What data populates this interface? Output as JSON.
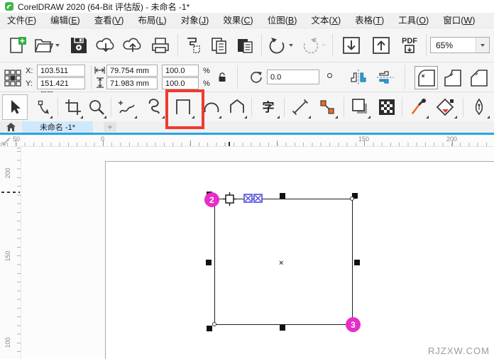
{
  "window": {
    "title": "CorelDRAW 2020 (64-Bit 评估版) - 未命名 -1*"
  },
  "menubar": {
    "items": [
      {
        "label": "文件",
        "key": "F"
      },
      {
        "label": "编辑",
        "key": "E"
      },
      {
        "label": "查看",
        "key": "V"
      },
      {
        "label": "布局",
        "key": "L"
      },
      {
        "label": "对象",
        "key": "J"
      },
      {
        "label": "效果",
        "key": "C"
      },
      {
        "label": "位图",
        "key": "B"
      },
      {
        "label": "文本",
        "key": "X"
      },
      {
        "label": "表格",
        "key": "T"
      },
      {
        "label": "工具",
        "key": "O"
      },
      {
        "label": "窗口",
        "key": "W"
      }
    ]
  },
  "toolbar": {
    "zoom_level": "65%",
    "pdf_label": "PDF"
  },
  "propbar": {
    "x_label": "X:",
    "x_value": "103.511 mm",
    "y_label": "Y:",
    "y_value": "151.421 mm",
    "width_value": "79.754 mm",
    "height_value": "71.983 mm",
    "scale_h": "100.0",
    "scale_v": "100.0",
    "percent": "%",
    "angle_value": "0.0"
  },
  "toolbox": {
    "text_tool_glyph": "字"
  },
  "tabbar": {
    "doc_tab": "未命名 -1*",
    "new_tab_label": "+"
  },
  "rulers": {
    "horizontal": [
      "50",
      "0",
      "150",
      "200"
    ],
    "vertical": [
      "200",
      "150",
      "100"
    ]
  },
  "annotations": {
    "step2": "2",
    "step3": "3"
  },
  "selection": {
    "center_mark": "×"
  },
  "watermark": "RJZXW.COM",
  "colors": {
    "magenta": "#e72ec7",
    "red_box": "#ee3a30",
    "active_tab": "#cfe8fb",
    "blue_line": "#29a4e4",
    "accent_blue": "#2b9fd9",
    "accent_orange": "#f26b21",
    "logo_green": "#3db54a"
  }
}
